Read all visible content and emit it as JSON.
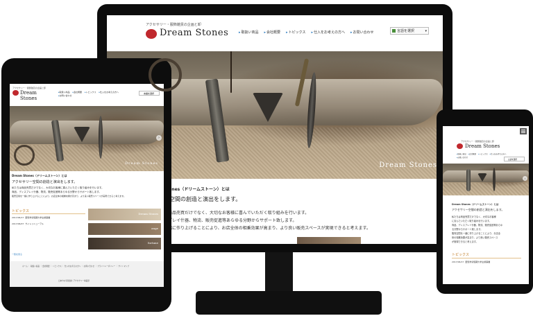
{
  "site": {
    "tagline": "アクセサリー・服飾雑貨の企画と卸",
    "logo": "Dream Stones",
    "nav": [
      "取扱い商品",
      "会社概要",
      "トピックス",
      "仕入をお考えの方へ",
      "お問い合わせ"
    ],
    "lang_button": "言語を選択",
    "hero_caption": "Dream Stones",
    "intro_title": "Dream Stones（ドリームストーン）とは",
    "intro_sub": "アクセサリー空間の創造と演出をします。",
    "desktop_intro_title": "Stones（ドリームストーン）とは",
    "desktop_intro_sub": "ー空間の創造と演出をします。",
    "desktop_lines": [
      "は商品売買だけでなく、大切なお客様に喜んでいただく取り組みを行います。",
      "イプレイ什器、物流、販売促進等あらゆる分野からサポート致します。",
      "一緒に作り上げることにより、お店全体の相乗効果が高まり、より良い販売スペースが実現できると考えます。"
    ],
    "tablet_lines": [
      "私たちは商品売買だけでなく、大切なお客様に喜んでいただく取り組みを行います。",
      "商品、ディスプレイ什器、物流、販売促進等あらゆる分野からサポート致します。",
      "販売空間を一緒に作り上げることにより、お店全体の相乗効果が高まり、より良い販売スペースが実現できると考えます。"
    ],
    "phone_lines": [
      "私たちは商品売買だけでなく、大切なお客様",
      "に喜んでいただく取り組みを行います。",
      "商品、ディスプレイ什器、物流、販売促進等あらゆ",
      "る分野からサポート致します。",
      "販売空間を一緒に作り上げることにより、お店全",
      "体の相乗効果が高まり、より良い販売スペース",
      "が実現できると考えます。"
    ],
    "topics_title": "トピックス",
    "news": [
      {
        "date": "2017/06/17",
        "title": "愛知学泉短期大学主催事業"
      },
      {
        "date": "2017/06/07",
        "title": "サイトリニューアル"
      }
    ],
    "banners": [
      "Dream Stones",
      "ange",
      "fortune"
    ],
    "more_link": "一覧を見る",
    "footer_nav": "ホーム ｜ 取扱い商品 ｜ 会社概要 ｜ トピックス ｜ 仕入をお考えの方へ ｜ お問い合わせ ｜ プライバシーポリシー ｜ サイトマップ",
    "copyright": "日本やの有限会社 アクセサリー事業部"
  }
}
